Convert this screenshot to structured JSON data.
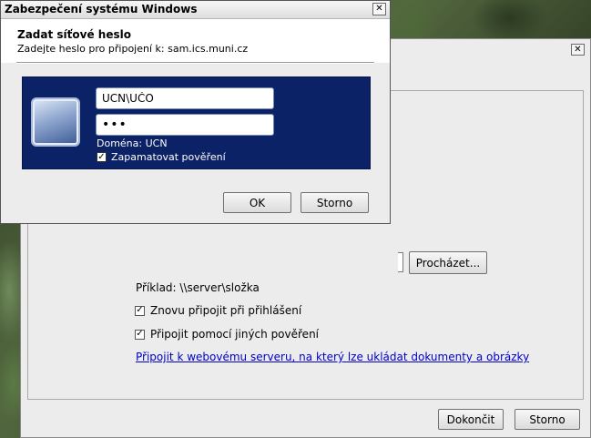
{
  "dialog": {
    "title": "Zabezpečení systému Windows",
    "heading": "Zadat síťové heslo",
    "subheading": "Zadejte heslo pro připojení k: sam.ics.muni.cz",
    "username_value": "UCN\\UČO",
    "password_mask": "•••",
    "domain_label": "Doména: UCN",
    "remember_label": "Zapamatovat pověření",
    "remember_checked": true,
    "ok_label": "OK",
    "cancel_label": "Storno",
    "close_glyph": "✕",
    "panel_color": "#0c2266"
  },
  "wizard": {
    "browse_label": "Procházet...",
    "example_text": "Příklad: \\\\server\\složka",
    "reconnect_label": "Znovu připojit při přihlášení",
    "reconnect_checked": true,
    "other_creds_label": "Připojit pomocí jiných pověření",
    "other_creds_checked": true,
    "webserver_link": "Připojit k webovému serveru, na který lze ukládat dokumenty a obrázky",
    "finish_label": "Dokončit",
    "cancel_label": "Storno",
    "close_glyph": "✕",
    "link_color": "#0000cc"
  },
  "icons": {
    "user_tile": "user-tile-icon",
    "close": "close-icon",
    "check": "✓"
  }
}
